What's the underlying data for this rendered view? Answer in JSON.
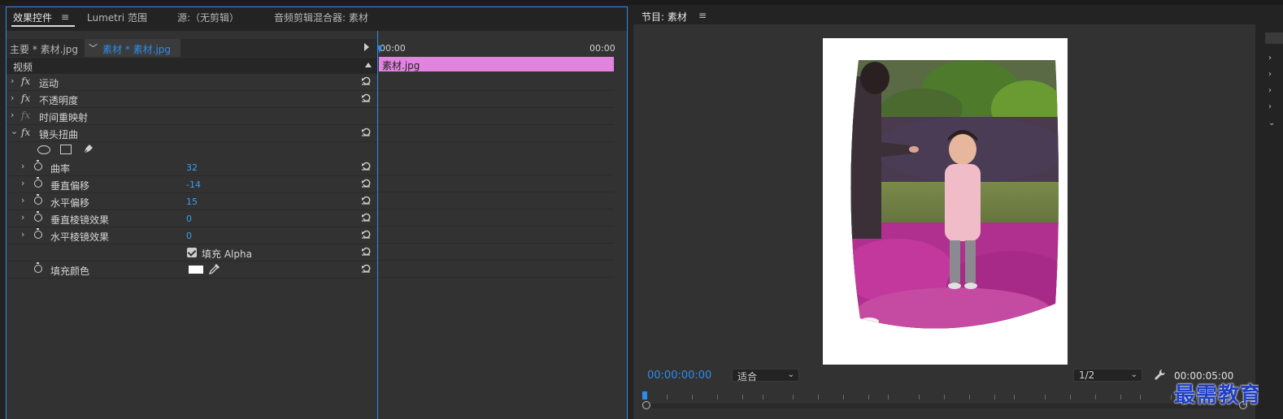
{
  "tabs": {
    "effect_controls": "效果控件",
    "lumetri": "Lumetri 范围",
    "source": "源:（无剪辑）",
    "audio_mixer": "音频剪辑混合器: 素材"
  },
  "breadcrumb": {
    "main": "主要 * 素材.jpg",
    "clip": "素材 * 素材.jpg"
  },
  "video_header": "视频",
  "effects": [
    {
      "label": "运动"
    },
    {
      "label": "不透明度"
    },
    {
      "label": "时间重映射"
    },
    {
      "label": "镜头扭曲"
    }
  ],
  "lens_props": [
    {
      "label": "曲率",
      "value": "32"
    },
    {
      "label": "垂直偏移",
      "value": "-14"
    },
    {
      "label": "水平偏移",
      "value": "15"
    },
    {
      "label": "垂直棱镜效果",
      "value": "0"
    },
    {
      "label": "水平棱镜效果",
      "value": "0"
    }
  ],
  "fill_alpha_label": "填充 Alpha",
  "fill_color_label": "填充颜色",
  "timeline": {
    "time_start": "00:00",
    "time_end": "00:00",
    "clip_name": "素材.jpg"
  },
  "program": {
    "title": "节目: 素材",
    "timecode_current": "00:00:00:00",
    "fit": "适合",
    "resolution": "1/2",
    "timecode_duration": "00:00:05:00"
  },
  "watermark": "最需教育",
  "colors": {
    "accent": "#2d8ceb",
    "clip": "#e184df",
    "value_blue": "#3c9df5"
  }
}
